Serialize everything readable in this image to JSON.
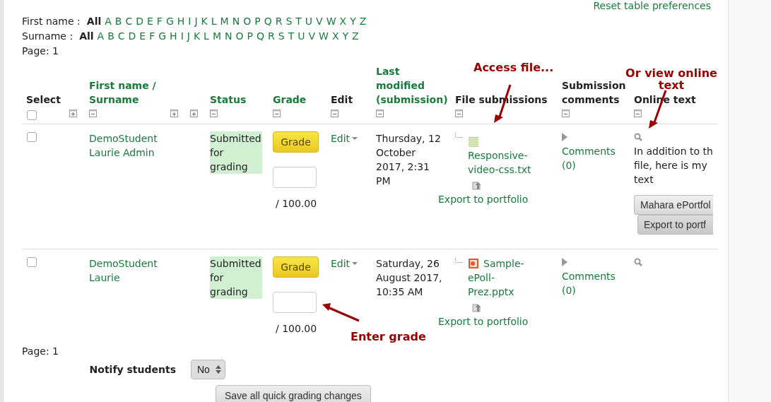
{
  "reset_link": "Reset table preferences",
  "initial_filters": [
    {
      "label": "First name :",
      "items": [
        {
          "text": "All",
          "selected": true
        },
        {
          "text": "A",
          "selected": false
        },
        {
          "text": "B",
          "selected": false
        },
        {
          "text": "C",
          "selected": false
        },
        {
          "text": "D",
          "selected": false
        },
        {
          "text": "E",
          "selected": false
        },
        {
          "text": "F",
          "selected": false
        },
        {
          "text": "G",
          "selected": false
        },
        {
          "text": "H",
          "selected": false
        },
        {
          "text": "I",
          "selected": false
        },
        {
          "text": "J",
          "selected": false
        },
        {
          "text": "K",
          "selected": false
        },
        {
          "text": "L",
          "selected": false
        },
        {
          "text": "M",
          "selected": false
        },
        {
          "text": "N",
          "selected": false
        },
        {
          "text": "O",
          "selected": false
        },
        {
          "text": "P",
          "selected": false
        },
        {
          "text": "Q",
          "selected": false
        },
        {
          "text": "R",
          "selected": false
        },
        {
          "text": "S",
          "selected": false
        },
        {
          "text": "T",
          "selected": false
        },
        {
          "text": "U",
          "selected": false
        },
        {
          "text": "V",
          "selected": false
        },
        {
          "text": "W",
          "selected": false
        },
        {
          "text": "X",
          "selected": false
        },
        {
          "text": "Y",
          "selected": false
        },
        {
          "text": "Z",
          "selected": false
        }
      ]
    },
    {
      "label": "Surname :",
      "items": [
        {
          "text": "All",
          "selected": true
        },
        {
          "text": "A",
          "selected": false
        },
        {
          "text": "B",
          "selected": false
        },
        {
          "text": "C",
          "selected": false
        },
        {
          "text": "D",
          "selected": false
        },
        {
          "text": "E",
          "selected": false
        },
        {
          "text": "F",
          "selected": false
        },
        {
          "text": "G",
          "selected": false
        },
        {
          "text": "H",
          "selected": false
        },
        {
          "text": "I",
          "selected": false
        },
        {
          "text": "J",
          "selected": false
        },
        {
          "text": "K",
          "selected": false
        },
        {
          "text": "L",
          "selected": false
        },
        {
          "text": "M",
          "selected": false
        },
        {
          "text": "N",
          "selected": false
        },
        {
          "text": "O",
          "selected": false
        },
        {
          "text": "P",
          "selected": false
        },
        {
          "text": "Q",
          "selected": false
        },
        {
          "text": "R",
          "selected": false
        },
        {
          "text": "S",
          "selected": false
        },
        {
          "text": "T",
          "selected": false
        },
        {
          "text": "U",
          "selected": false
        },
        {
          "text": "V",
          "selected": false
        },
        {
          "text": "W",
          "selected": false
        },
        {
          "text": "X",
          "selected": false
        },
        {
          "text": "Y",
          "selected": false
        },
        {
          "text": "Z",
          "selected": false
        }
      ]
    }
  ],
  "page_top": "Page: 1",
  "columns": [
    {
      "label": "Select",
      "kind": "checkbox",
      "checked": false
    },
    {
      "kind": "show"
    },
    {
      "label": "First name / Surname",
      "sortable": true,
      "kind": "hide"
    },
    {
      "kind": "show"
    },
    {
      "kind": "show"
    },
    {
      "label": "Status",
      "sortable": true,
      "kind": "hide"
    },
    {
      "label": "Grade",
      "sortable": true,
      "kind": "hide"
    },
    {
      "label": "Edit",
      "sortable": false,
      "kind": "hide"
    },
    {
      "label": "Last modified (submission)",
      "sortable": true,
      "kind": "hide"
    },
    {
      "label": "File submissions",
      "sortable": false,
      "kind": "hide"
    },
    {
      "label": "Submission comments",
      "sortable": false,
      "kind": "hide"
    },
    {
      "label": "Online text",
      "sortable": false,
      "kind": "hide"
    }
  ],
  "rows": [
    {
      "checked": false,
      "name": "DemoStudent Laurie Admin",
      "status": {
        "text": "Submitted for grading",
        "kind": "submitted"
      },
      "grade_button": "Grade",
      "grade_max": "/ 100.00",
      "edit": "Edit",
      "modified": "Thursday, 12 October 2017, 2:31 PM",
      "file": {
        "name": "Responsive-video-css.txt",
        "kind": "text"
      },
      "export": "Export to portfolio",
      "comments": "Comments (0)",
      "online_text": [
        "In addition to th",
        "file, here is my",
        "text"
      ],
      "online_buttons": [
        "Mahara ePortfol",
        "Export to portf"
      ]
    },
    {
      "checked": false,
      "name": "DemoStudent Laurie",
      "status": {
        "text": "Submitted for grading",
        "kind": "submitted"
      },
      "grade_button": "Grade",
      "grade_max": "/ 100.00",
      "edit": "Edit",
      "modified": "Saturday, 26 August 2017, 10:35 AM",
      "file": {
        "name": "Sample-ePoll-Prez.pptx",
        "kind": "slides"
      },
      "export": "Export to portfolio",
      "comments": "Comments (0)"
    }
  ],
  "page_bottom": "Page: 1",
  "notify": {
    "label": "Notify students",
    "value": "No"
  },
  "save_button": "Save all quick grading changes",
  "annotations": [
    {
      "text": "Access file...",
      "kind": "file"
    },
    {
      "text": "Or view online text",
      "kind": "online"
    },
    {
      "text": "Enter grade",
      "kind": "grade"
    }
  ]
}
